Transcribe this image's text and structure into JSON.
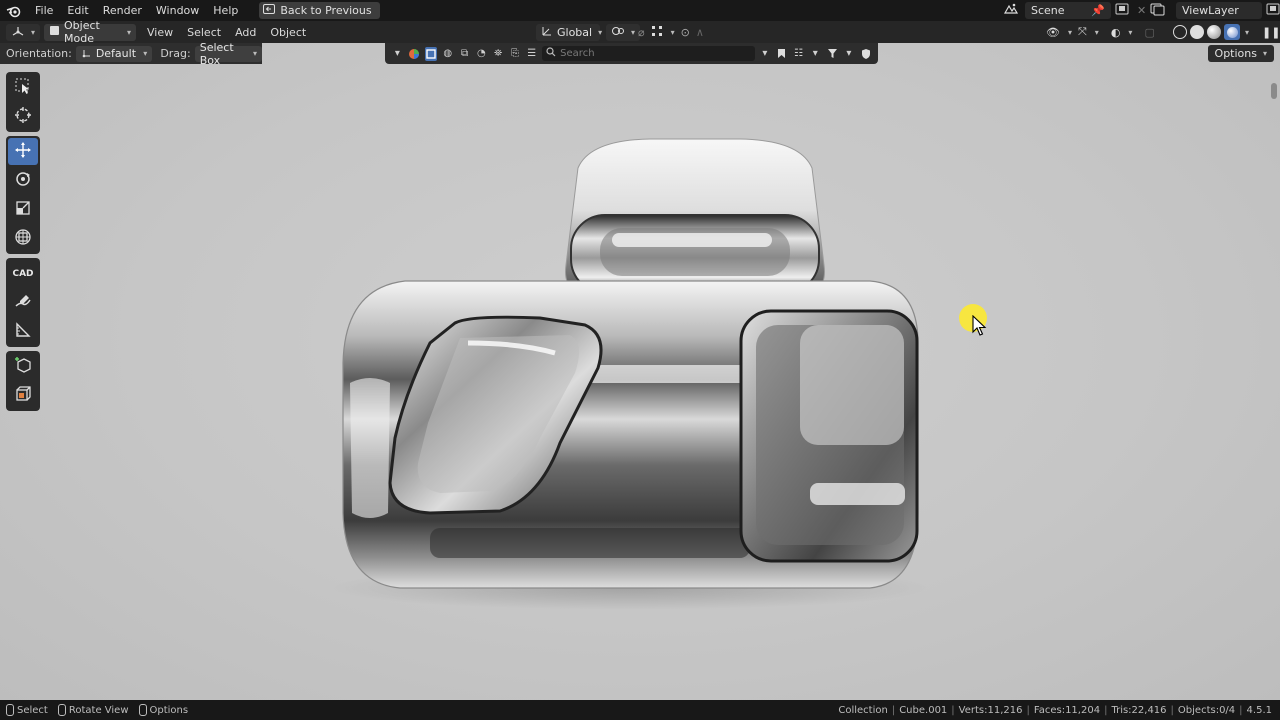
{
  "topbar": {
    "menu": [
      "File",
      "Edit",
      "Render",
      "Window",
      "Help"
    ],
    "back_button": "Back to Previous",
    "scene": "Scene",
    "view_layer": "ViewLayer"
  },
  "header": {
    "mode": "Object Mode",
    "menu": [
      "View",
      "Select",
      "Add",
      "Object"
    ],
    "transform_orientation": "Global"
  },
  "tool_settings": {
    "orientation_label": "Orientation:",
    "orientation_value": "Default",
    "drag_label": "Drag:",
    "drag_value": "Select Box"
  },
  "viewport": {
    "search_placeholder": "Search",
    "options_label": "Options",
    "toolbar_cad_label": "CAD"
  },
  "statusbar": {
    "hints": [
      "Select",
      "Rotate View",
      "Options"
    ],
    "stats": [
      "Collection",
      "Cube.001",
      "Verts:11,216",
      "Faces:11,204",
      "Tris:22,416",
      "Objects:0/4",
      "4.5.1"
    ]
  },
  "colors": {
    "accent": "#4772b3",
    "viewport_bg": "#c4c4c4",
    "cursor_highlight": "#ffeb28"
  }
}
